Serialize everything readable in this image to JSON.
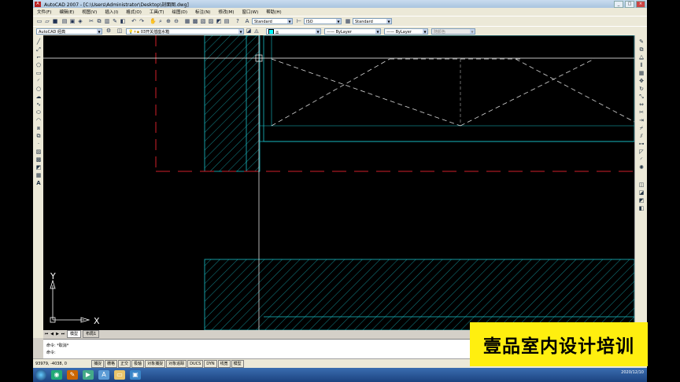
{
  "window": {
    "title": "AutoCAD 2007 - [C:\\Users\\Administrator\\Desktop\\剖面图.dwg]",
    "buttons": [
      "_",
      "□",
      "×"
    ]
  },
  "menu": [
    "文件(F)",
    "编辑(E)",
    "视图(V)",
    "插入(I)",
    "格式(O)",
    "工具(T)",
    "绘图(D)",
    "标注(N)",
    "修改(M)",
    "窗口(W)",
    "帮助(H)"
  ],
  "toolbar": {
    "text_style": "Standard",
    "dim_style": "ISO",
    "table_style": "Standard",
    "workspace": "AutoCAD 经典",
    "layer": "03开关插座水箱",
    "color": "青",
    "linetype": "ByLayer",
    "lineweight": "ByLayer",
    "plotstyle": "随颜色"
  },
  "tabs": {
    "model": "模型",
    "layout": "布局1"
  },
  "ucs": {
    "y_label": "Y",
    "x_label": "X"
  },
  "command": {
    "line1": "命令: *取消*",
    "line2": "命令:"
  },
  "status": {
    "coords": "93979, -4038, 0",
    "buttons": [
      "捕捉",
      "栅格",
      "正交",
      "极轴",
      "对象捕捉",
      "对象追踪",
      "DUCS",
      "DYN",
      "线宽",
      "模型"
    ]
  },
  "taskbar": {
    "date": "2020/12/10"
  },
  "watermark": "壹品室内设计培训",
  "colors": {
    "canvas": "#000000",
    "hatch": "#19c0c8",
    "center_line": "#d0202a",
    "crosshair": "#ffffff",
    "watermark_bg": "#ffef0f"
  }
}
